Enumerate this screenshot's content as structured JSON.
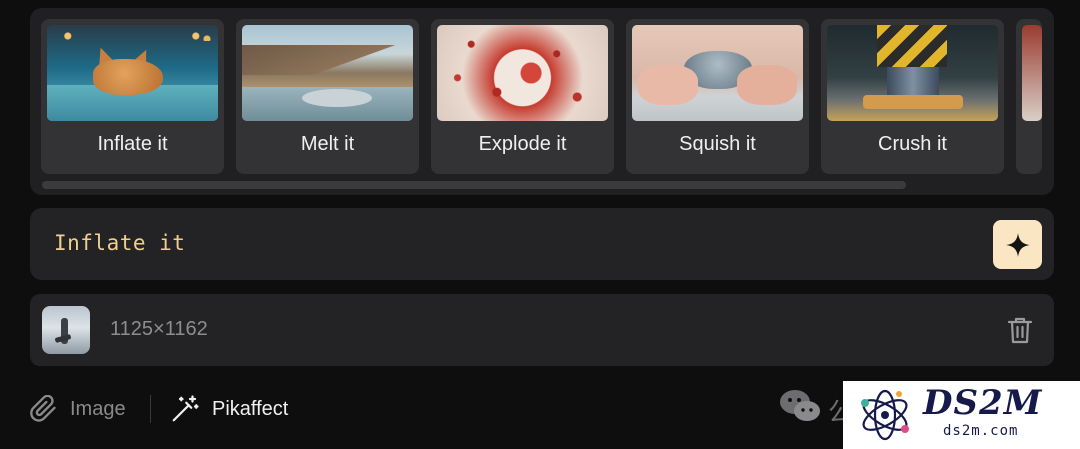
{
  "effects": {
    "items": [
      {
        "label": "Inflate it"
      },
      {
        "label": "Melt it"
      },
      {
        "label": "Explode it"
      },
      {
        "label": "Squish it"
      },
      {
        "label": "Crush it"
      }
    ]
  },
  "prompt": {
    "value": "Inflate it",
    "generate_icon": "sparkle-icon"
  },
  "attachment": {
    "dimensions": "1125×1162",
    "delete_icon": "trash-icon"
  },
  "toolbar": {
    "image_label": "Image",
    "image_icon": "paperclip-icon",
    "pikaffect_label": "Pikaffect",
    "pikaffect_icon": "magic-wand-icon"
  },
  "overlay": {
    "partial_glyph": "公"
  },
  "watermark": {
    "title": "DS2M",
    "subtitle": "ds2m.com"
  },
  "colors": {
    "background": "#0e0e0f",
    "panel": "#232325",
    "card": "#333335",
    "prompt_text": "#f1cf90",
    "accent_button": "#fbe6c4"
  }
}
